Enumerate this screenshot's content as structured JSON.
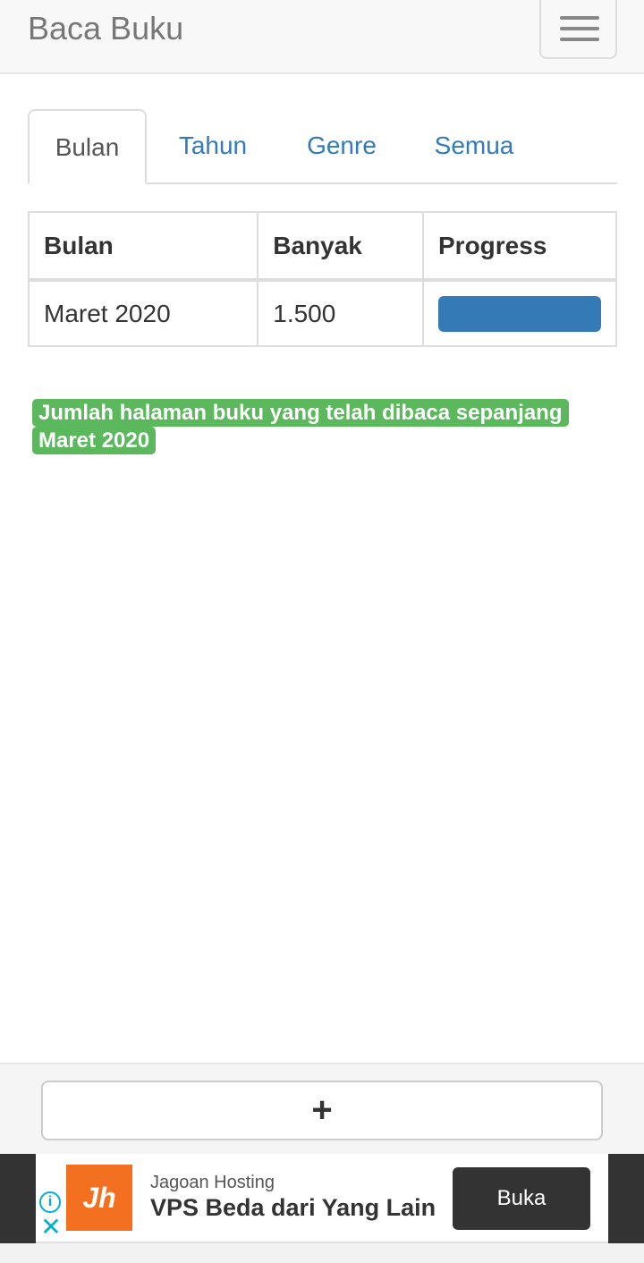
{
  "navbar": {
    "brand": "Baca Buku",
    "menu_icon": "hamburger-menu-icon"
  },
  "tabs": [
    {
      "label": "Bulan",
      "active": true
    },
    {
      "label": "Tahun",
      "active": false
    },
    {
      "label": "Genre",
      "active": false
    },
    {
      "label": "Semua",
      "active": false
    }
  ],
  "table": {
    "headers": [
      "Bulan",
      "Banyak",
      "Progress"
    ],
    "rows": [
      {
        "bulan": "Maret 2020",
        "banyak": "1.500",
        "progress_percent": 100
      }
    ]
  },
  "label": {
    "text": "Jumlah halaman buku yang telah dibaca sepanjang Maret 2020"
  },
  "footer": {
    "add_label": "+"
  },
  "ad": {
    "info_icon": "info-icon",
    "close_icon": "close-icon",
    "logo_text": "Jh",
    "advertiser": "Jagoan Hosting",
    "headline": "VPS Beda dari Yang Lain",
    "cta": "Buka"
  },
  "colors": {
    "link": "#337ab7",
    "progress": "#337ab7",
    "label_bg": "#5cb85c",
    "ad_logo": "#f37021",
    "ad_icon": "#00aecd"
  }
}
